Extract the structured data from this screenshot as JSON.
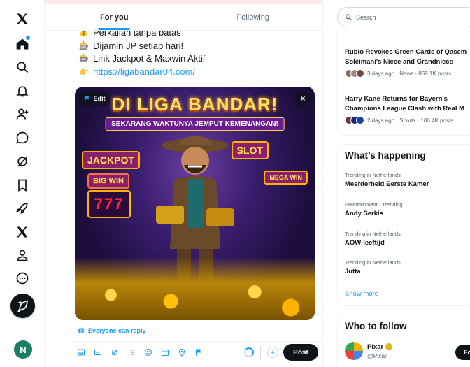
{
  "nav": {
    "items": [
      {
        "icon": "x-logo-icon"
      },
      {
        "icon": "home-icon"
      },
      {
        "icon": "explore-icon"
      },
      {
        "icon": "notifications-icon"
      },
      {
        "icon": "follow-icon"
      },
      {
        "icon": "messages-icon"
      },
      {
        "icon": "grok-icon"
      },
      {
        "icon": "bookmarks-icon"
      },
      {
        "icon": "jobs-icon"
      },
      {
        "icon": "premium-x-icon"
      },
      {
        "icon": "profile-icon"
      },
      {
        "icon": "more-icon"
      }
    ],
    "compose_icon": "feather-plus-icon",
    "avatar_initial": "N"
  },
  "tabs": [
    {
      "label": "For you",
      "active": true
    },
    {
      "label": "Following",
      "active": false
    }
  ],
  "post": {
    "lines": [
      {
        "emoji": "💰",
        "text": "Perkalian tanpa batas"
      },
      {
        "emoji": "🎰",
        "text": "Dijamin JP setiap hari!"
      },
      {
        "emoji": "🎰",
        "text": "Link Jackpot & Maxwin Aktif"
      },
      {
        "emoji": "👉",
        "text": "https://ligabandar04.com/",
        "is_link": true
      }
    ],
    "media": {
      "edit_label": "Edit",
      "close_label": "×",
      "banner_title": "DI LIGA BANDAR!",
      "banner_subtitle": "SEKARANG WAKTUNYA JEMPUT KEMENANGAN!",
      "sign_jackpot": "JACKPOT",
      "sign_bigwin": "BIG WIN",
      "sign_slot": "SLOT",
      "sign_megawin": "MEGA WIN",
      "slot_reels": "777"
    },
    "reply_setting": "Everyone can reply",
    "post_button": "Post",
    "plus_label": "+"
  },
  "sidebar": {
    "search_placeholder": "Search",
    "news": [
      {
        "title": "Rubio Revokes Green Cards of Qasem",
        "title2": "Soleimani's Niece and Grandniece",
        "meta": "3 days ago · News · 859.1K posts"
      },
      {
        "title": "Harry Kane Returns for Bayern's",
        "title2": "Champions League Clash with Real M",
        "meta": "2 days ago · Sports · 100.4K posts"
      }
    ],
    "happening_title": "What’s happening",
    "trends": [
      {
        "category": "Trending in Netherlands",
        "name": "Meerderheid Eerste Kamer"
      },
      {
        "category": "Entertainment · Trending",
        "name": "Andy Serkis"
      },
      {
        "category": "Trending in Netherlands",
        "name": "AOW-leeftijd"
      },
      {
        "category": "Trending in Netherlands",
        "name": "Jutta"
      }
    ],
    "show_more": "Show more",
    "follow_title": "Who to follow",
    "follow": {
      "name": "Pixar",
      "handle": "@Pixar",
      "button": "Fo"
    }
  },
  "colors": {
    "accent": "#1d9bf0",
    "text": "#0f1419",
    "muted": "#536471",
    "border": "#eff3f4"
  }
}
